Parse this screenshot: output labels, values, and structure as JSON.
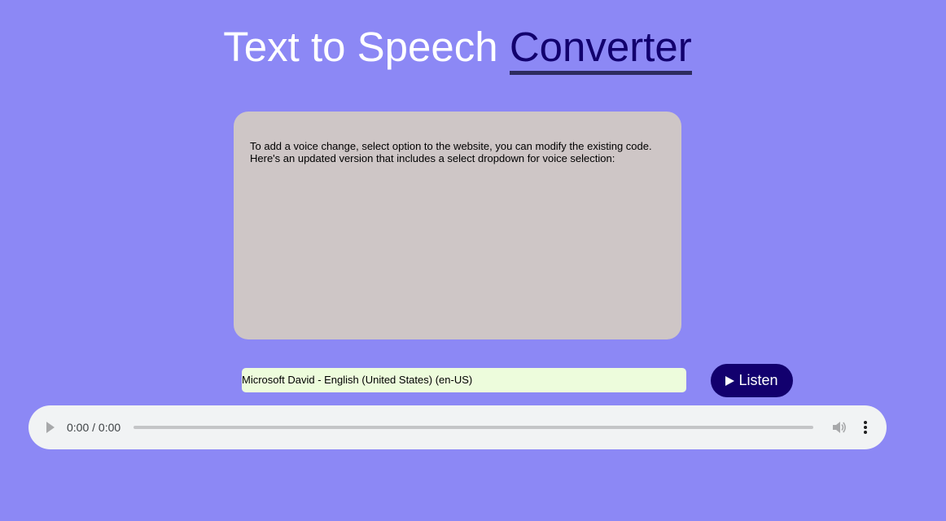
{
  "header": {
    "title_main": "Text to Speech",
    "title_accent": "Converter"
  },
  "editor": {
    "text": "To add a voice change, select option to the website, you can modify the existing code.\nHere's an updated version that includes a select dropdown for voice selection:"
  },
  "voice": {
    "selected": "Microsoft David - English (United States) (en-US)"
  },
  "listen_button": {
    "label": "Listen",
    "icon": "play-icon"
  },
  "audio": {
    "time": "0:00 / 0:00",
    "icons": [
      "play-icon",
      "volume-icon",
      "more-vert-icon"
    ]
  },
  "colors": {
    "background": "#8c88f5",
    "accent": "#12006e",
    "textarea_bg": "#cec6c6",
    "select_bg": "#edfcdc",
    "player_bg": "#f1f3f4"
  }
}
